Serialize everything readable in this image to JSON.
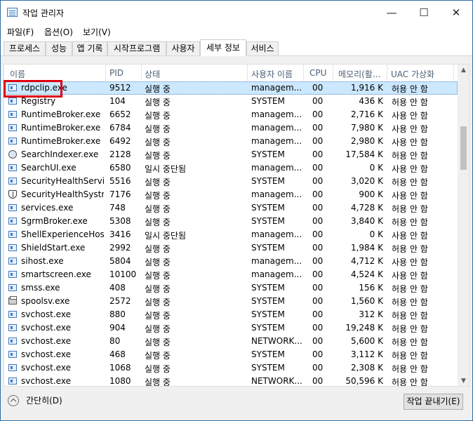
{
  "window": {
    "title": "작업 관리자",
    "controls": {
      "minimize": "—",
      "maximize": "☐",
      "close": "✕"
    }
  },
  "menu": [
    "파일(F)",
    "옵션(O)",
    "보기(V)"
  ],
  "tabs": [
    "프로세스",
    "성능",
    "앱 기록",
    "시작프로그램",
    "사용자",
    "세부 정보",
    "서비스"
  ],
  "active_tab": "세부 정보",
  "columns": {
    "name": "이름",
    "pid": "PID",
    "status": "상태",
    "user": "사용자 이름",
    "cpu": "CPU",
    "memory": "메모리(활...",
    "uac": "UAC 가상화"
  },
  "processes": [
    {
      "name": "rdpclip.exe",
      "pid": "9512",
      "status": "실행 중",
      "user": "managem...",
      "cpu": "00",
      "memory": "1,916 K",
      "uac": "허용 안 함",
      "icon": "app-icon"
    },
    {
      "name": "Registry",
      "pid": "104",
      "status": "실행 중",
      "user": "SYSTEM",
      "cpu": "00",
      "memory": "436 K",
      "uac": "허용 안 함",
      "icon": "app-icon"
    },
    {
      "name": "RuntimeBroker.exe",
      "pid": "6652",
      "status": "실행 중",
      "user": "managem...",
      "cpu": "00",
      "memory": "2,716 K",
      "uac": "사용 안 함",
      "icon": "app-icon"
    },
    {
      "name": "RuntimeBroker.exe",
      "pid": "6784",
      "status": "실행 중",
      "user": "managem...",
      "cpu": "00",
      "memory": "7,980 K",
      "uac": "사용 안 함",
      "icon": "app-icon"
    },
    {
      "name": "RuntimeBroker.exe",
      "pid": "6492",
      "status": "실행 중",
      "user": "managem...",
      "cpu": "00",
      "memory": "2,980 K",
      "uac": "사용 안 함",
      "icon": "app-icon"
    },
    {
      "name": "SearchIndexer.exe",
      "pid": "2128",
      "status": "실행 중",
      "user": "SYSTEM",
      "cpu": "00",
      "memory": "17,584 K",
      "uac": "허용 안 함",
      "icon": "search-icon"
    },
    {
      "name": "SearchUI.exe",
      "pid": "6580",
      "status": "일시 중단됨",
      "user": "managem...",
      "cpu": "00",
      "memory": "0 K",
      "uac": "사용 안 함",
      "icon": "app-icon"
    },
    {
      "name": "SecurityHealthServic...",
      "pid": "5516",
      "status": "실행 중",
      "user": "SYSTEM",
      "cpu": "00",
      "memory": "3,020 K",
      "uac": "허용 안 함",
      "icon": "app-icon"
    },
    {
      "name": "SecurityHealthSystra...",
      "pid": "7176",
      "status": "실행 중",
      "user": "managem...",
      "cpu": "00",
      "memory": "900 K",
      "uac": "사용 안 함",
      "icon": "shield-icon"
    },
    {
      "name": "services.exe",
      "pid": "748",
      "status": "실행 중",
      "user": "SYSTEM",
      "cpu": "00",
      "memory": "4,728 K",
      "uac": "허용 안 함",
      "icon": "app-icon"
    },
    {
      "name": "SgrmBroker.exe",
      "pid": "5308",
      "status": "실행 중",
      "user": "SYSTEM",
      "cpu": "00",
      "memory": "3,840 K",
      "uac": "허용 안 함",
      "icon": "app-icon"
    },
    {
      "name": "ShellExperienceHost....",
      "pid": "3416",
      "status": "일시 중단됨",
      "user": "managem...",
      "cpu": "00",
      "memory": "0 K",
      "uac": "사용 안 함",
      "icon": "app-icon"
    },
    {
      "name": "ShieldStart.exe",
      "pid": "2992",
      "status": "실행 중",
      "user": "SYSTEM",
      "cpu": "00",
      "memory": "1,984 K",
      "uac": "허용 안 함",
      "icon": "app-icon"
    },
    {
      "name": "sihost.exe",
      "pid": "5804",
      "status": "실행 중",
      "user": "managem...",
      "cpu": "00",
      "memory": "4,712 K",
      "uac": "사용 안 함",
      "icon": "app-icon"
    },
    {
      "name": "smartscreen.exe",
      "pid": "10100",
      "status": "실행 중",
      "user": "managem...",
      "cpu": "00",
      "memory": "4,524 K",
      "uac": "사용 안 함",
      "icon": "app-icon"
    },
    {
      "name": "smss.exe",
      "pid": "408",
      "status": "실행 중",
      "user": "SYSTEM",
      "cpu": "00",
      "memory": "156 K",
      "uac": "허용 안 함",
      "icon": "app-icon"
    },
    {
      "name": "spoolsv.exe",
      "pid": "2572",
      "status": "실행 중",
      "user": "SYSTEM",
      "cpu": "00",
      "memory": "1,560 K",
      "uac": "허용 안 함",
      "icon": "printer-icon"
    },
    {
      "name": "svchost.exe",
      "pid": "880",
      "status": "실행 중",
      "user": "SYSTEM",
      "cpu": "00",
      "memory": "312 K",
      "uac": "허용 안 함",
      "icon": "app-icon"
    },
    {
      "name": "svchost.exe",
      "pid": "904",
      "status": "실행 중",
      "user": "SYSTEM",
      "cpu": "00",
      "memory": "19,248 K",
      "uac": "허용 안 함",
      "icon": "app-icon"
    },
    {
      "name": "svchost.exe",
      "pid": "80",
      "status": "실행 중",
      "user": "NETWORK...",
      "cpu": "00",
      "memory": "5,600 K",
      "uac": "허용 안 함",
      "icon": "app-icon"
    },
    {
      "name": "svchost.exe",
      "pid": "468",
      "status": "실행 중",
      "user": "SYSTEM",
      "cpu": "00",
      "memory": "3,112 K",
      "uac": "허용 안 함",
      "icon": "app-icon"
    },
    {
      "name": "svchost.exe",
      "pid": "1068",
      "status": "실행 중",
      "user": "SYSTEM",
      "cpu": "00",
      "memory": "2,308 K",
      "uac": "허용 안 함",
      "icon": "app-icon"
    },
    {
      "name": "svchost.exe",
      "pid": "1080",
      "status": "실행 중",
      "user": "NETWORK...",
      "cpu": "00",
      "memory": "50,596 K",
      "uac": "허용 안 함",
      "icon": "app-icon"
    }
  ],
  "selected_process": "rdpclip.exe",
  "footer": {
    "collapse_label": "간단히(D)",
    "end_task_label": "작업 끝내기(E)"
  },
  "colors": {
    "selection": "#cce8ff",
    "highlight_box": "#e0000f"
  }
}
